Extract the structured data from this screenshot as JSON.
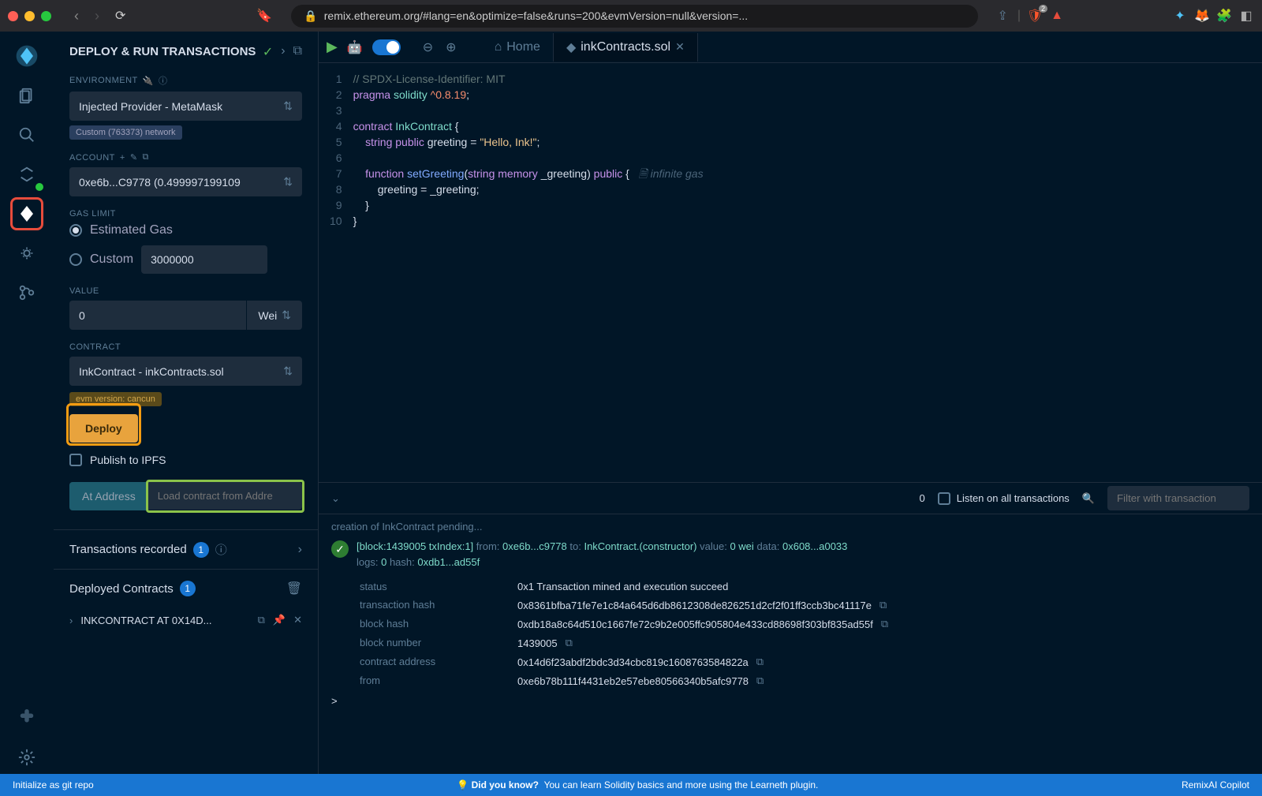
{
  "browser": {
    "url": "remix.ethereum.org/#lang=en&optimize=false&runs=200&evmVersion=null&version=...",
    "brave_count": "2"
  },
  "panel": {
    "title": "DEPLOY & RUN TRANSACTIONS",
    "env_label": "ENVIRONMENT",
    "env_value": "Injected Provider - MetaMask",
    "network_badge": "Custom (763373) network",
    "account_label": "ACCOUNT",
    "account_value": "0xe6b...C9778 (0.499997199109",
    "gas_label": "GAS LIMIT",
    "gas_estimated": "Estimated Gas",
    "gas_custom": "Custom",
    "gas_custom_value": "3000000",
    "value_label": "VALUE",
    "value_amount": "0",
    "value_unit": "Wei",
    "contract_label": "CONTRACT",
    "contract_value": "InkContract - inkContracts.sol",
    "evm_badge": "evm version: cancun",
    "deploy_label": "Deploy",
    "publish_label": "Publish to IPFS",
    "at_address_label": "At Address",
    "at_address_placeholder": "Load contract from Addre",
    "transactions_recorded": "Transactions recorded",
    "transactions_count": "1",
    "deployed_label": "Deployed Contracts",
    "deployed_count": "1",
    "deployed_item": "INKCONTRACT AT 0X14D..."
  },
  "tabs": {
    "home": "Home",
    "file": "inkContracts.sol"
  },
  "code": {
    "l1_comment": "// SPDX-License-Identifier: MIT",
    "l2_pragma": "pragma",
    "l2_solidity": "solidity",
    "l2_version": "^0.8.19",
    "l4_contract": "contract",
    "l4_name": "InkContract",
    "l5_string": "string",
    "l5_public": "public",
    "l5_greeting": "greeting",
    "l5_val": "\"Hello, Ink!\"",
    "l7_function": "function",
    "l7_name": "setGreeting",
    "l7_string": "string",
    "l7_memory": "memory",
    "l7_param": "_greeting",
    "l7_public": "public",
    "l7_hint": "infinite gas",
    "l8_assign": "greeting = _greeting;"
  },
  "terminal": {
    "count": "0",
    "listen_label": "Listen on all transactions",
    "filter_placeholder": "Filter with transaction",
    "pending": "creation of InkContract pending...",
    "block": "[block:1439005 txIndex:1]",
    "from_label": "from:",
    "from_val": "0xe6b...c9778",
    "to_label": "to:",
    "to_val": "InkContract.(constructor)",
    "value_label": "value:",
    "value_val": "0 wei",
    "data_label": "data:",
    "data_val": "0x608...a0033",
    "logs_label": "logs:",
    "logs_val": "0",
    "hash_label": "hash:",
    "hash_val": "0xdb1...ad55f",
    "details": {
      "status": {
        "k": "status",
        "v": "0x1 Transaction mined and execution succeed"
      },
      "txhash": {
        "k": "transaction hash",
        "v": "0x8361bfba71fe7e1c84a645d6db8612308de826251d2cf2f01ff3ccb3bc41117e"
      },
      "blockhash": {
        "k": "block hash",
        "v": "0xdb18a8c64d510c1667fe72c9b2e005ffc905804e433cd88698f303bf835ad55f"
      },
      "blocknum": {
        "k": "block number",
        "v": "1439005"
      },
      "caddr": {
        "k": "contract address",
        "v": "0x14d6f23abdf2bdc3d34cbc819c1608763584822a"
      },
      "from": {
        "k": "from",
        "v": "0xe6b78b111f4431eb2e57ebe80566340b5afc9778"
      }
    },
    "prompt": ">"
  },
  "status": {
    "git": "Initialize as git repo",
    "dyk": "Did you know?",
    "dyk_text": "You can learn Solidity basics and more using the Learneth plugin.",
    "copilot": "RemixAI Copilot"
  }
}
